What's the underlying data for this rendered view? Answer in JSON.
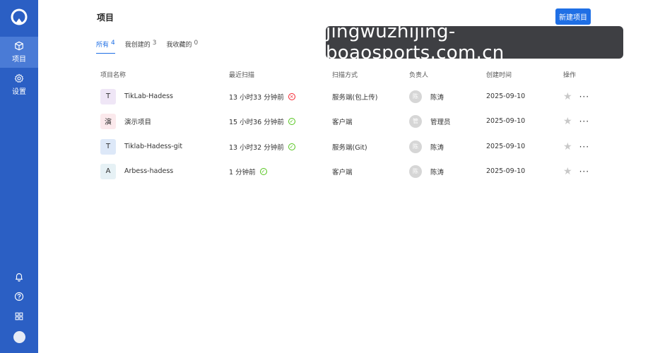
{
  "sidebar": {
    "nav": [
      {
        "label": "项目",
        "icon": "cube-icon"
      },
      {
        "label": "设置",
        "icon": "gear-icon"
      }
    ],
    "bottom_icons": [
      "bell-icon",
      "help-icon",
      "apps-grid-icon"
    ]
  },
  "header": {
    "title": "项目",
    "new_button": "新建项目"
  },
  "tabs": [
    {
      "label": "所有",
      "count": "4"
    },
    {
      "label": "我创建的",
      "count": "3"
    },
    {
      "label": "我收藏的",
      "count": "0"
    }
  ],
  "watermark": "jingwuzhijing-boaosports.com.cn",
  "table": {
    "columns": [
      "项目名称",
      "最近扫描",
      "扫描方式",
      "负责人",
      "创建时间",
      "操作"
    ],
    "rows": [
      {
        "badge": "T",
        "badge_color": "#efe6f6",
        "name": "TikLab-Hadess",
        "scan": "13 小时33 分钟前",
        "status": "error",
        "method": "服务端(包上传)",
        "avatar": "陈",
        "owner": "陈涛",
        "created": "2025-09-10"
      },
      {
        "badge": "演",
        "badge_color": "#fbe9ec",
        "name": "演示项目",
        "scan": "15 小时36 分钟前",
        "status": "ok",
        "method": "客户端",
        "avatar": "管",
        "owner": "管理员",
        "created": "2025-09-10"
      },
      {
        "badge": "T",
        "badge_color": "#dde8f8",
        "name": "Tiklab-Hadess-git",
        "scan": "13 小时32 分钟前",
        "status": "ok",
        "method": "服务端(Git)",
        "avatar": "陈",
        "owner": "陈涛",
        "created": "2025-09-10"
      },
      {
        "badge": "A",
        "badge_color": "#e6f1f5",
        "name": "Arbess-hadess",
        "scan": "1 分钟前",
        "status": "ok",
        "method": "客户端",
        "avatar": "陈",
        "owner": "陈涛",
        "created": "2025-09-10"
      }
    ]
  },
  "colors": {
    "sidebar": "#2b5fc4",
    "accent": "#1f6fe5",
    "status_ok": "#52c41a",
    "status_error": "#f5222d"
  }
}
